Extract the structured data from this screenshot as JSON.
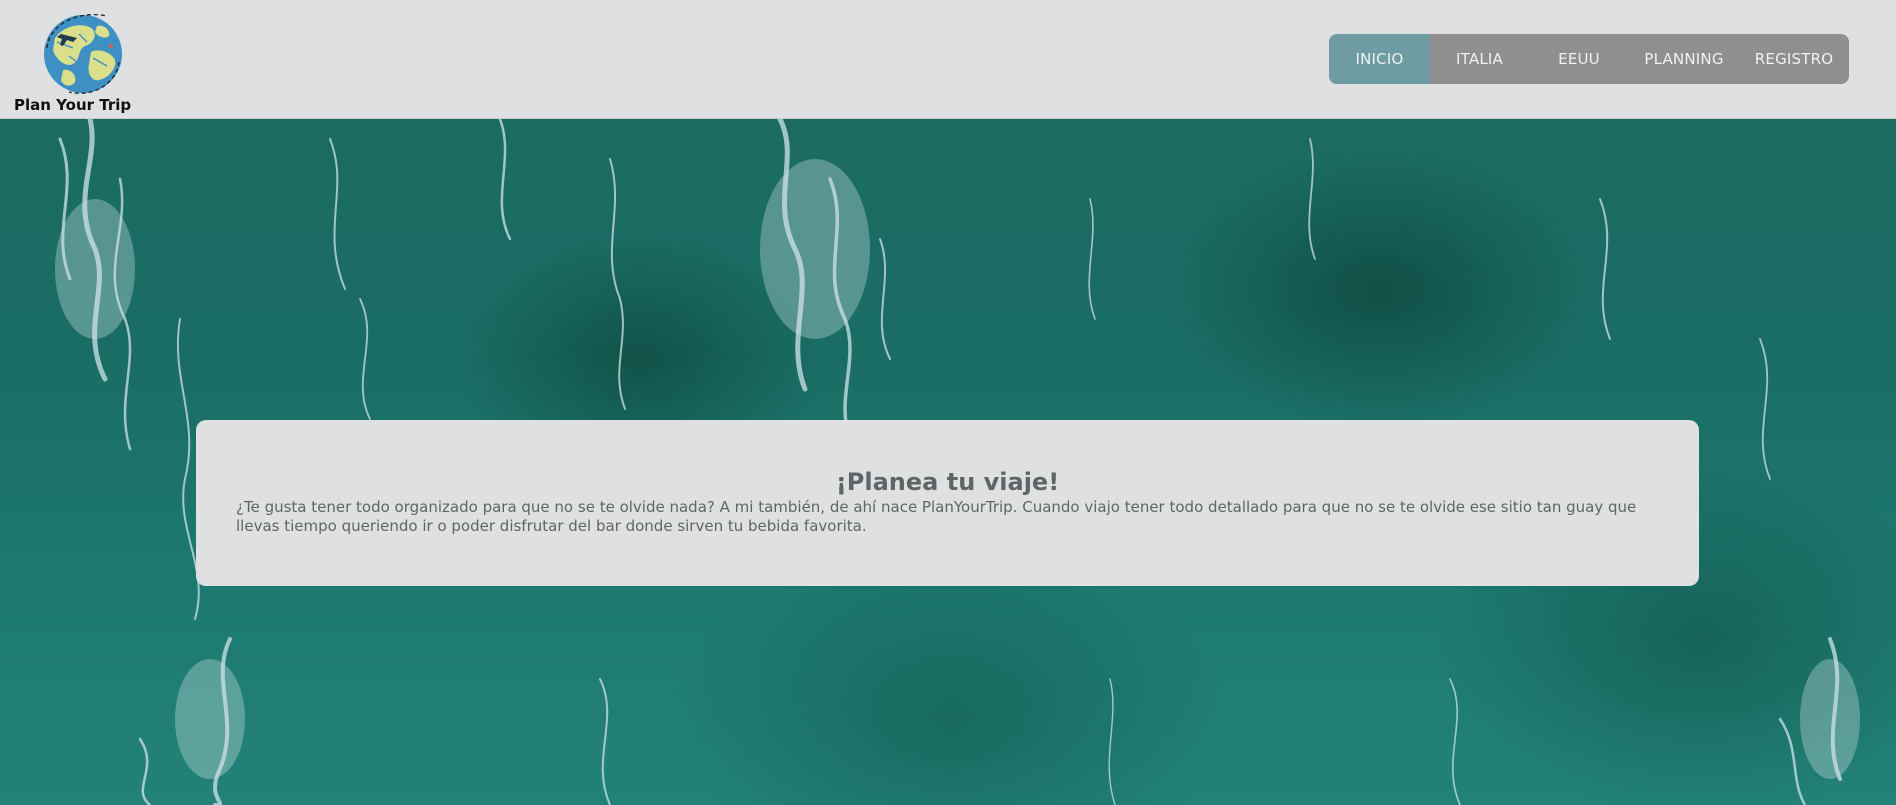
{
  "header": {
    "logo_text": "Plan Your Trip",
    "logo_icon": "globe-airplane-icon"
  },
  "nav": {
    "items": [
      {
        "label": "INICIO",
        "active": true
      },
      {
        "label": "ITALIA",
        "active": false
      },
      {
        "label": "EEUU",
        "active": false
      },
      {
        "label": "PLANNING",
        "active": false
      },
      {
        "label": "REGISTRO",
        "active": false
      }
    ],
    "colors": {
      "bar": "#8f8f8f",
      "active": "#6f9ba3",
      "text": "#f1f1f1"
    }
  },
  "hero": {
    "background": "ocean-waves-image",
    "colors": {
      "sea": "#1b6b62",
      "foam": "#cfe3e6"
    }
  },
  "card": {
    "title": "¡Planea tu viaje!",
    "text": "¿Te gusta tener todo organizado para que no se te olvide nada? A mi también, de ahí nace PlanYourTrip. Cuando viajo tener todo detallado para que no se te olvide ese sitio tan guay que llevas tiempo queriendo ir o poder disfrutar del bar donde sirven tu bebida favorita."
  }
}
